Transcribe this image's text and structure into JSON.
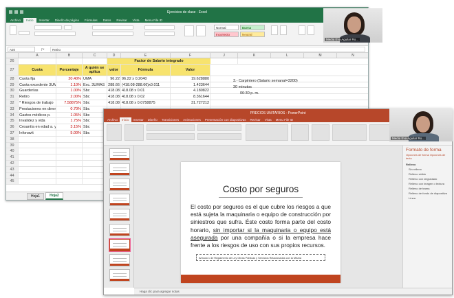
{
  "excel": {
    "title": "Ejercicios de clase - Excel",
    "tabs": [
      "Archivo",
      "Inicio",
      "Insertar",
      "Diseño de página",
      "Fórmulas",
      "Datos",
      "Revisar",
      "Vista",
      "Menu File ID"
    ],
    "styles": [
      "Normal",
      "Buena",
      "Incorrecto",
      "Neutral"
    ],
    "name_box": "A20",
    "formula_value": "Retiro",
    "column_letters": [
      "A",
      "B",
      "C",
      "D",
      "E",
      "F",
      "J",
      "K",
      "L",
      "M",
      "N",
      "O"
    ],
    "top_title": "Factor de Salario integrado",
    "headers": {
      "rownum": "27",
      "cuota": "Cuota",
      "porcentaje": "Porcentaje",
      "aplica": "A quién se aplica",
      "valor": "valor",
      "formula": "Fórmula",
      "valor2": "Valor"
    },
    "rows": [
      {
        "n": "28",
        "a": "Cuota fija",
        "b": "20.40%",
        "c": "UMA",
        "d": "96.22",
        "e": "96.22 x 0.2040",
        "f": "19.628880"
      },
      {
        "n": "29",
        "a": "Cuota excedente 3UMAS",
        "b": "1.10%",
        "c": "Exc. 3UMAS",
        "d": "288.66",
        "e": "(418.08-288.66)x0.011",
        "f": "1.423644"
      },
      {
        "n": "30",
        "a": "Guarderías",
        "b": "1.00%",
        "c": "Sbc",
        "d": "418.08",
        "e": "418.08 x 0.01",
        "f": "4.180822"
      },
      {
        "n": "31",
        "a": "Retiro",
        "b": "2.00%",
        "c": "Sbc",
        "d": "418.08",
        "e": "418.08 x 0.02",
        "f": "8.361644"
      },
      {
        "n": "32",
        "a": "* Riesgos de trabajo",
        "b": "7.58875%",
        "c": "Sbc",
        "d": "418.08",
        "e": "418.08 x 0.0758875",
        "f": "31.727212"
      },
      {
        "n": "33",
        "a": "Prestaciones en dinero",
        "b": "0.70%",
        "c": "Sbc",
        "d": "",
        "e": "",
        "f": ""
      },
      {
        "n": "34",
        "a": "Gastos médicos p.",
        "b": "1.05%",
        "c": "Sbc",
        "d": "",
        "e": "",
        "f": ""
      },
      {
        "n": "35",
        "a": "Invalidez y vida",
        "b": "1.75%",
        "c": "Sbc",
        "d": "",
        "e": "",
        "f": ""
      },
      {
        "n": "36",
        "a": "Cesantía en edad a. y v.",
        "b": "3.15%",
        "c": "Sbc",
        "d": "",
        "e": "",
        "f": ""
      },
      {
        "n": "37",
        "a": "Infonavit",
        "b": "5.00%",
        "c": "Sbc",
        "d": "",
        "e": "",
        "f": ""
      },
      {
        "n": "38",
        "a": "",
        "b": "",
        "c": "",
        "d": "",
        "e": "",
        "f": ""
      },
      {
        "n": "39",
        "a": "",
        "b": "",
        "c": "",
        "d": "",
        "e": "",
        "f": ""
      },
      {
        "n": "40",
        "a": "",
        "b": "",
        "c": "",
        "d": "",
        "e": "",
        "f": ""
      },
      {
        "n": "41",
        "a": "",
        "b": "",
        "c": "",
        "d": "",
        "e": "",
        "f": ""
      },
      {
        "n": "42",
        "a": "",
        "b": "",
        "c": "",
        "d": "",
        "e": "",
        "f": ""
      },
      {
        "n": "43",
        "a": "",
        "b": "",
        "c": "",
        "d": "",
        "e": "",
        "f": ""
      },
      {
        "n": "44",
        "a": "",
        "b": "",
        "c": "",
        "d": "",
        "e": "",
        "f": ""
      },
      {
        "n": "45",
        "a": "",
        "b": "",
        "c": "",
        "d": "",
        "e": "",
        "f": ""
      }
    ],
    "notes": [
      "3.- Carpintero (Salario semanal=3200)",
      "30 minutos",
      "06:30 p. m."
    ],
    "sheet_tabs": [
      "Hoja1",
      "Hoja2"
    ]
  },
  "camera1": {
    "name": "Media Eva Aguilar Ro..."
  },
  "camera2": {
    "name": "Media Eva Aguilar Ro..."
  },
  "ppt": {
    "title": "PRECIOS UNITARIOS - PowerPoint",
    "tabs": [
      "Archivo",
      "Inicio",
      "Insertar",
      "Diseño",
      "Transiciones",
      "Animaciones",
      "Presentación con diapositivas",
      "Revisar",
      "Vista",
      "Menu File ID"
    ],
    "slide": {
      "title": "Costo por seguros",
      "body_a": "El costo por seguros es el que cubre los riesgos a que está sujeta la maquinaria o equipo de construcción por siniestros que sufra. Éste costo forma parte del costo horario, ",
      "body_u": "sin importar si la maquinaria o equipo está asegurada",
      "body_b": " por una compañía o si la empresa hace frente a los riesgos de uso con sus propios recursos.",
      "caption": "Artículo 1 de Reglamento de Ley Obras Públicas y Servicios Relacionados con la Misma"
    },
    "pane": {
      "title": "Formato de forma",
      "subtitle": "Opciones de forma    Opciones de texto",
      "section": "Relleno",
      "items": [
        "Sin relleno",
        "Relleno sólido",
        "Relleno con degradado",
        "Relleno con imagen o textura",
        "Relleno de trama",
        "Relleno de fondo de diapositiva",
        "Línea"
      ]
    },
    "notes_placeholder": "Haga clic para agregar notas"
  }
}
